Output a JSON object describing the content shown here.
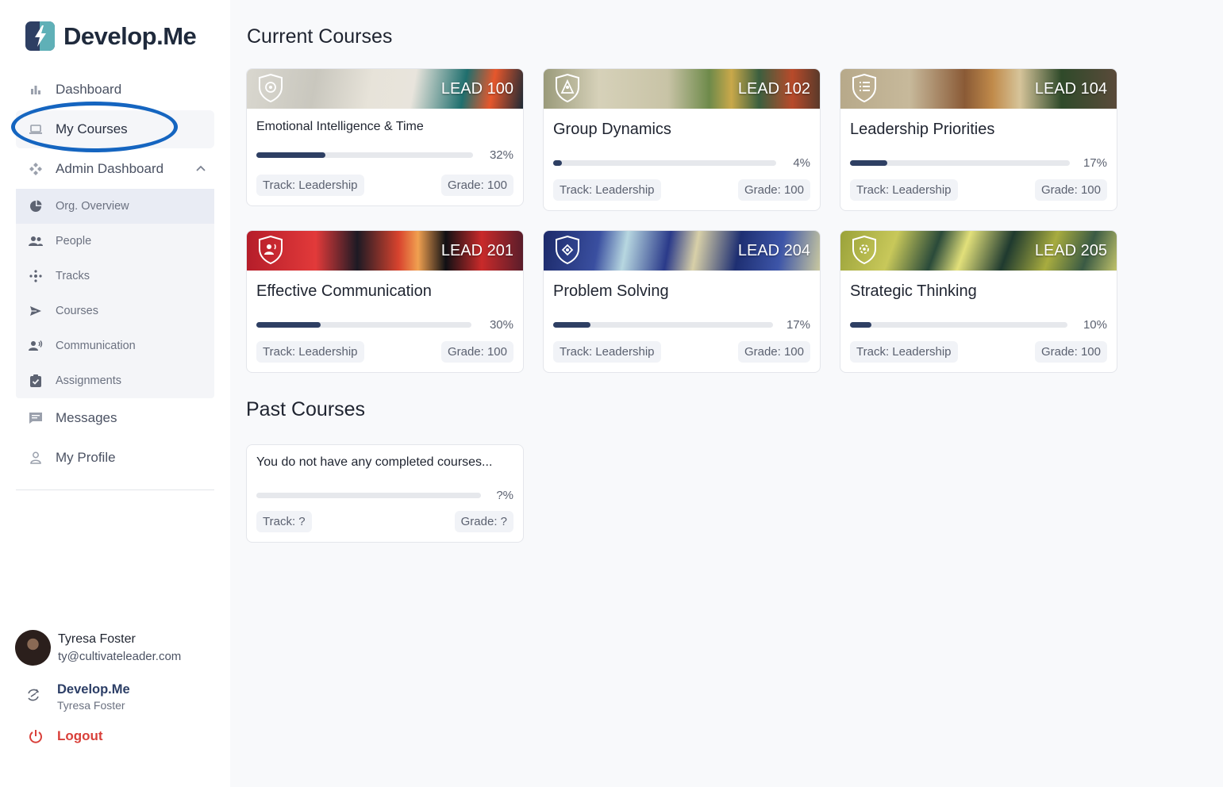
{
  "brand": {
    "name": "Develop.Me"
  },
  "nav": {
    "dashboard": "Dashboard",
    "my_courses": "My Courses",
    "admin_dashboard": "Admin Dashboard",
    "sub": {
      "org_overview": "Org. Overview",
      "people": "People",
      "tracks": "Tracks",
      "courses": "Courses",
      "communication": "Communication",
      "assignments": "Assignments"
    },
    "messages": "Messages",
    "my_profile": "My Profile"
  },
  "user": {
    "name": "Tyresa Foster",
    "email": "ty@cultivateleader.com"
  },
  "org": {
    "name": "Develop.Me",
    "user": "Tyresa Foster"
  },
  "logout": "Logout",
  "main": {
    "current_title": "Current Courses",
    "past_title": "Past Courses",
    "current_courses": [
      {
        "code": "LEAD 100",
        "title": "Emotional Intelligence & Time",
        "progress_label": "32%",
        "progress": 0.32,
        "track": "Track: Leadership",
        "grade": "Grade: 100"
      },
      {
        "code": "LEAD 102",
        "title": "Group Dynamics",
        "progress_label": "4%",
        "progress": 0.04,
        "track": "Track: Leadership",
        "grade": "Grade: 100"
      },
      {
        "code": "LEAD 104",
        "title": "Leadership Priorities",
        "progress_label": "17%",
        "progress": 0.17,
        "track": "Track: Leadership",
        "grade": "Grade: 100"
      },
      {
        "code": "LEAD 201",
        "title": "Effective Communication",
        "progress_label": "30%",
        "progress": 0.3,
        "track": "Track: Leadership",
        "grade": "Grade: 100"
      },
      {
        "code": "LEAD 204",
        "title": "Problem Solving",
        "progress_label": "17%",
        "progress": 0.17,
        "track": "Track: Leadership",
        "grade": "Grade: 100"
      },
      {
        "code": "LEAD 205",
        "title": "Strategic Thinking",
        "progress_label": "10%",
        "progress": 0.1,
        "track": "Track: Leadership",
        "grade": "Grade: 100"
      }
    ],
    "past_course": {
      "title": "You do not have any completed courses...",
      "progress_label": "?%",
      "progress": 0,
      "track": "Track: ?",
      "grade": "Grade: ?"
    }
  },
  "colors": {
    "accent": "#2e3f63",
    "logout": "#d9403a",
    "highlight": "#1565c0"
  }
}
